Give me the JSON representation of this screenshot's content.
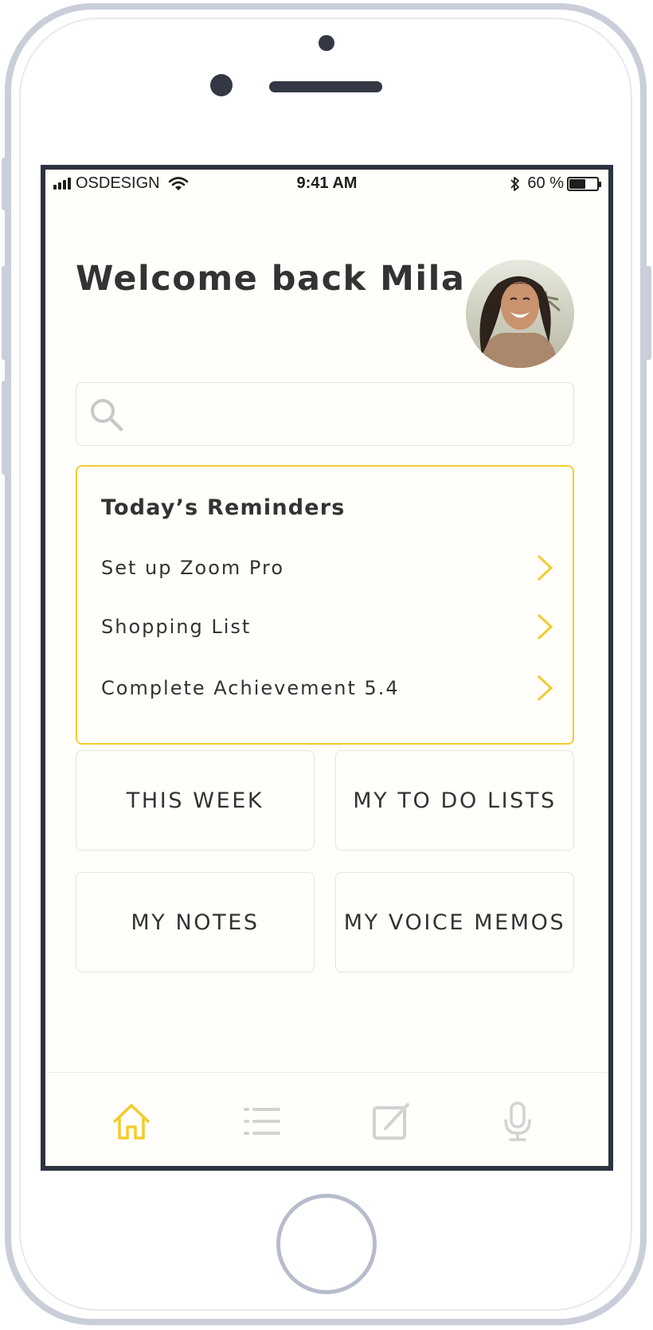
{
  "status_bar": {
    "carrier": "OSDESIGN",
    "time": "9:41 AM",
    "battery": "60 %",
    "battery_level": 0.6
  },
  "header": {
    "welcome": "Welcome back Mila"
  },
  "search": {
    "placeholder": ""
  },
  "reminders": {
    "title": "Today’s Reminders",
    "items": [
      {
        "label": "Set up Zoom Pro"
      },
      {
        "label": "Shopping List"
      },
      {
        "label": "Complete Achievement 5.4"
      }
    ]
  },
  "tiles": [
    {
      "label": "THIS WEEK"
    },
    {
      "label": "MY TO DO LISTS"
    },
    {
      "label": "MY NOTES"
    },
    {
      "label": "MY VOICE MEMOS"
    }
  ],
  "tab_bar": {
    "active_tab": "home",
    "tabs": [
      {
        "icon": "home-icon"
      },
      {
        "icon": "list-icon"
      },
      {
        "icon": "edit-icon"
      },
      {
        "icon": "microphone-icon"
      }
    ]
  },
  "colors": {
    "accent": "#f3cc2b",
    "screen_background": "#fffefa",
    "text": "#333333",
    "inactive_icon": "#d2d2d2",
    "phone_frame": "#c9ced9"
  }
}
